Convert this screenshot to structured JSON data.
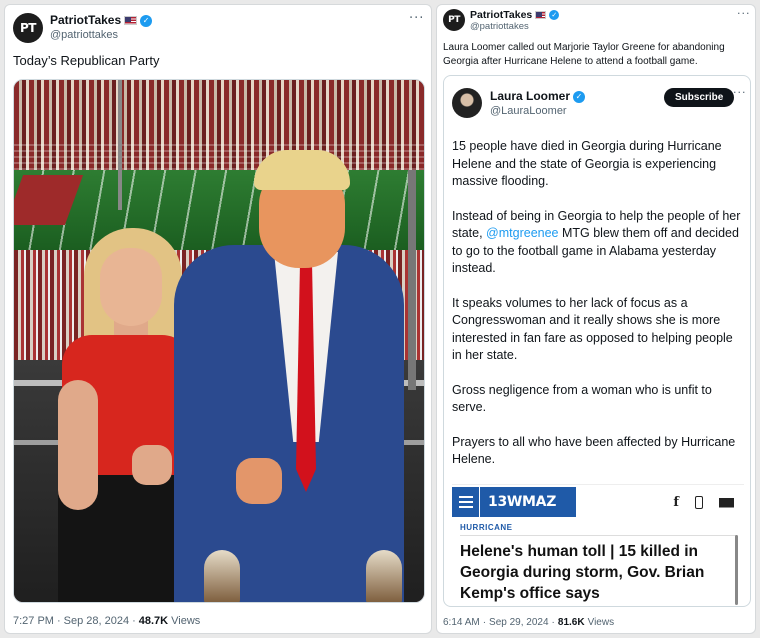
{
  "left_tweet": {
    "avatar_text": "PT",
    "display_name": "PatriotTakes",
    "handle": "@patriottakes",
    "text": "Today’s Republican Party",
    "time": "7:27 PM",
    "date": "Sep 28, 2024",
    "views_count": "48.7K",
    "views_label": "Views"
  },
  "right_tweet": {
    "avatar_text": "PT",
    "display_name": "PatriotTakes",
    "handle": "@patriottakes",
    "text": "Laura Loomer called out Marjorie Taylor Greene for abandoning Georgia after Hurricane Helene to attend a football game.",
    "time": "6:14 AM",
    "date": "Sep 29, 2024",
    "views_count": "81.6K",
    "views_label": "Views",
    "quote": {
      "display_name": "Laura Loomer",
      "handle": "@LauraLoomer",
      "subscribe_label": "Subscribe",
      "p1": "15 people have died in Georgia during Hurricane Helene and the state of Georgia is experiencing massive flooding.",
      "p2_before": "Instead of being in Georgia to help the people of her state, ",
      "p2_mention": "@mtgreenee",
      "p2_after": " MTG blew them off and decided to go to the football game in Alabama yesterday instead.",
      "p3": "It speaks volumes to her lack of focus as a Congresswoman and it really shows she is more interested in fan fare as opposed to helping people in her state.",
      "p4": "Gross negligence from a woman who is unfit to serve.",
      "p5": "Prayers to all who have been affected by Hurricane Helene.",
      "article": {
        "logo": "13WMAZ",
        "kicker": "HURRICANE",
        "headline": "Helene's human toll | 15 killed in Georgia during storm, Gov. Brian Kemp's office says",
        "facebook_glyph": "f"
      }
    }
  },
  "ui": {
    "more_glyph": "···",
    "separator": "·",
    "verified_glyph": "✓",
    "accent_color": "#1d9bf0",
    "icons": [
      "flag-icon",
      "verified-icon",
      "more-icon",
      "menu-icon",
      "facebook-icon",
      "phone-icon",
      "mail-icon"
    ]
  }
}
